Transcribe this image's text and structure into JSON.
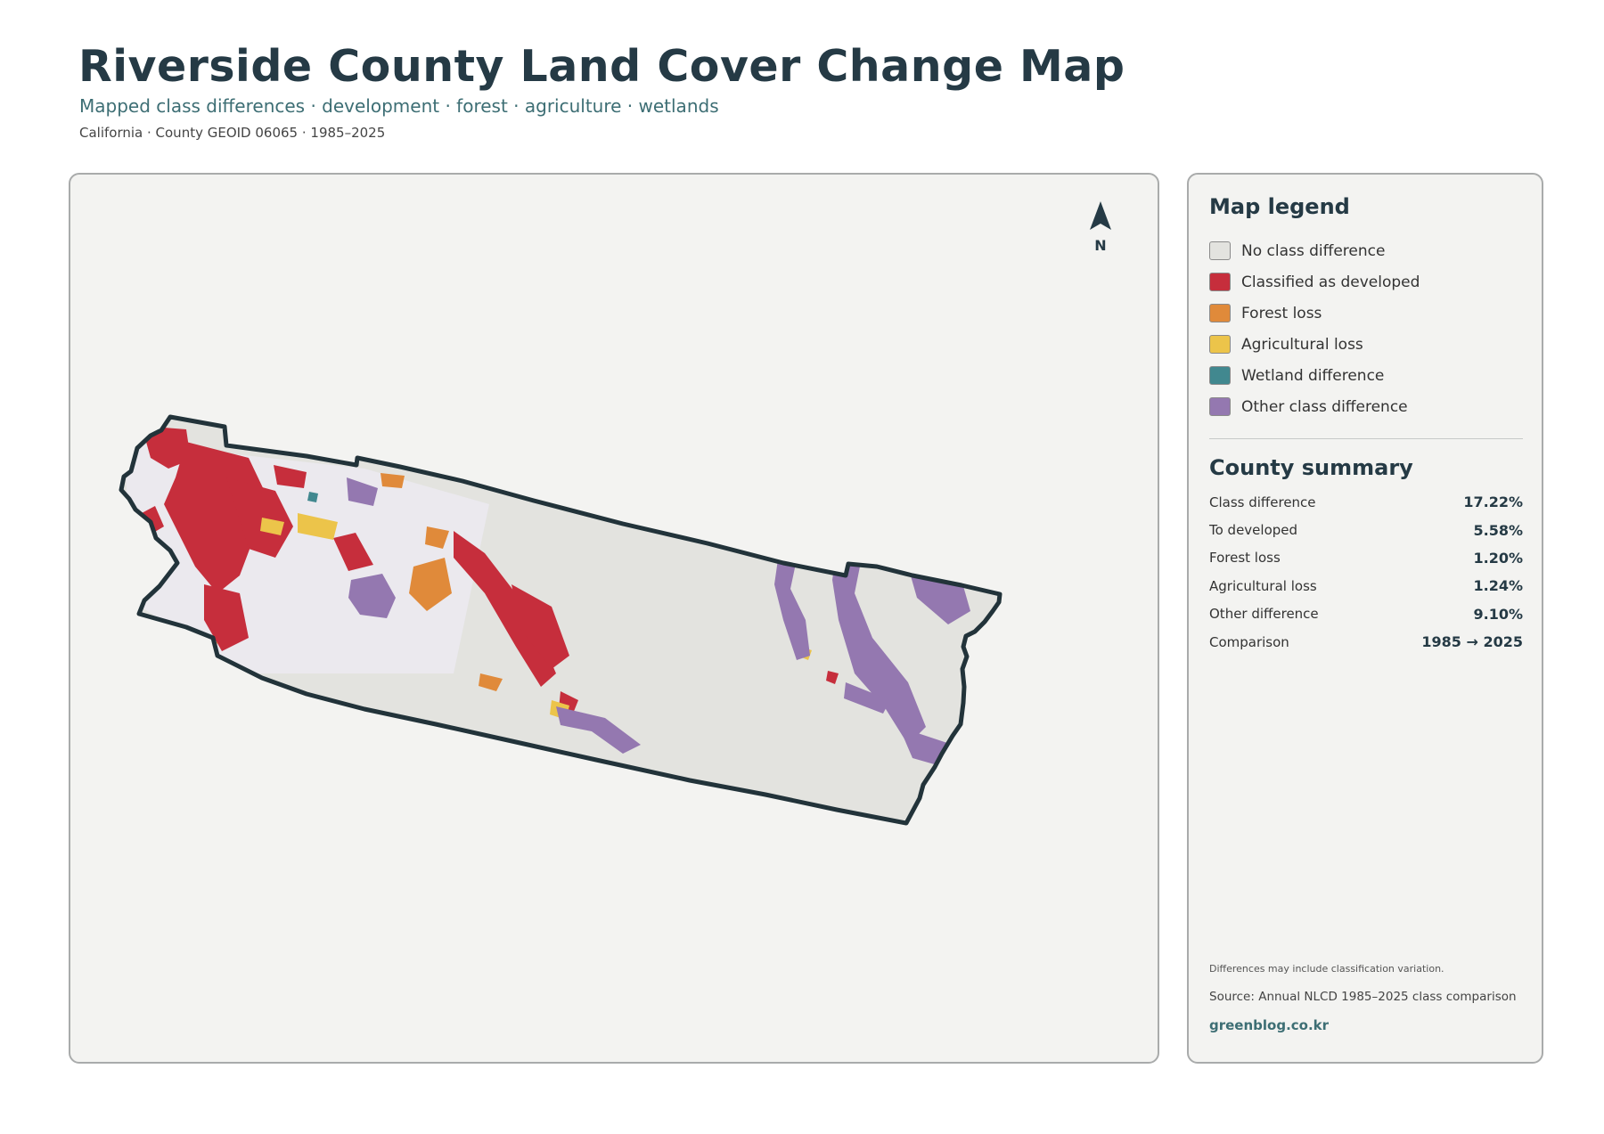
{
  "title": "Riverside County Land Cover Change Map",
  "subtitle": "Mapped class differences · development · forest · agriculture · wetlands",
  "meta": "California · County GEOID 06065 · 1985–2025",
  "map": {
    "north_label": "N",
    "colors": {
      "no_difference": "#e3e3df",
      "developed": "#c62e3c",
      "forest_loss": "#e08a3a",
      "agricultural_loss": "#ecc44a",
      "wetland": "#41888f",
      "other": "#9478b0",
      "outline": "#22333a"
    }
  },
  "legend": {
    "title": "Map legend",
    "items": [
      {
        "label": "No class difference",
        "color": "#e3e3df"
      },
      {
        "label": "Classified as developed",
        "color": "#c62e3c"
      },
      {
        "label": "Forest loss",
        "color": "#e08a3a"
      },
      {
        "label": "Agricultural loss",
        "color": "#ecc44a"
      },
      {
        "label": "Wetland difference",
        "color": "#41888f"
      },
      {
        "label": "Other class difference",
        "color": "#9478b0"
      }
    ]
  },
  "summary": {
    "title": "County summary",
    "rows": [
      {
        "label": "Class difference",
        "value": "17.22%"
      },
      {
        "label": "To developed",
        "value": "5.58%"
      },
      {
        "label": "Forest loss",
        "value": "1.20%"
      },
      {
        "label": "Agricultural loss",
        "value": "1.24%"
      },
      {
        "label": "Other difference",
        "value": "9.10%"
      },
      {
        "label": "Comparison",
        "value": "1985 → 2025"
      }
    ]
  },
  "footer": {
    "note": "Differences may include classification variation.",
    "source": "Source: Annual NLCD 1985–2025 class comparison",
    "website": "greenblog.co.kr"
  }
}
